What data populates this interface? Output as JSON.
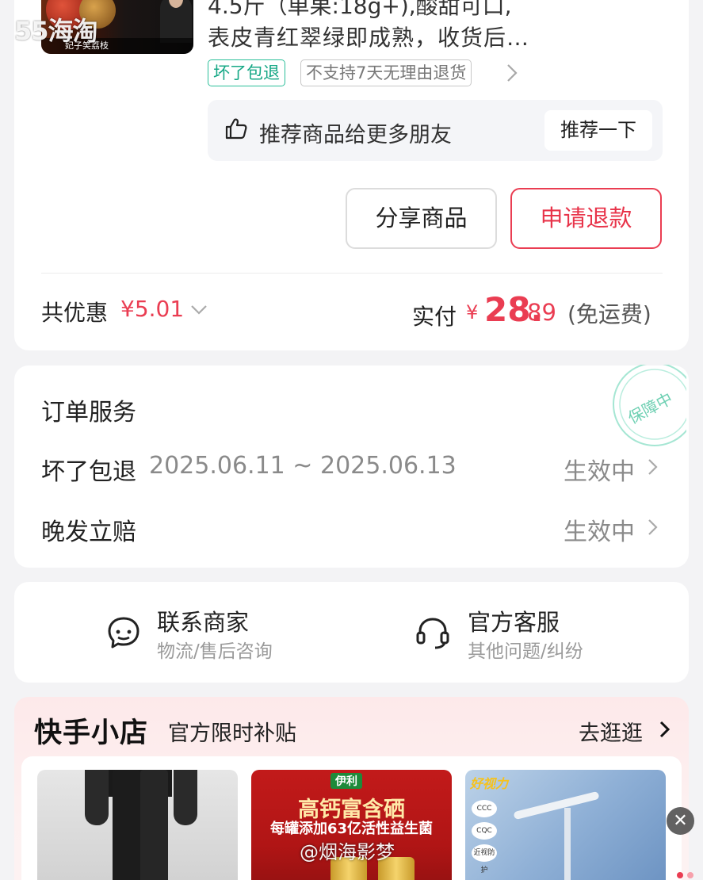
{
  "watermark_top": "55海淘",
  "product": {
    "thumb_caption": "妃子笑荔枝",
    "title_line1": "4.5斤（单果:18g+),酸甜可口,",
    "title_line2": "表皮青红翠绿即成熟，收货后…",
    "tags": [
      "坏了包退",
      "不支持7天无理由退货"
    ],
    "tag_more_icon": "chevron-right-icon"
  },
  "recommend": {
    "label": "推荐商品给更多朋友",
    "button": "推荐一下"
  },
  "actions": {
    "share": "分享商品",
    "refund": "申请退款"
  },
  "summary": {
    "discount_label": "共优惠",
    "discount_value": "¥5.01",
    "paid_label": "实付",
    "paid_currency": "¥",
    "paid_int": "28.",
    "paid_dec": "89",
    "shipping": "(免运费)"
  },
  "order_service": {
    "title": "订单服务",
    "stamp": "保障中",
    "rows": [
      {
        "label": "坏了包退",
        "date": "2025.06.11 ~ 2025.06.13",
        "status": "生效中"
      },
      {
        "label": "晚发立赔",
        "date": "",
        "status": "生效中"
      }
    ]
  },
  "contact": [
    {
      "title": "联系商家",
      "sub": "物流/售后咨询",
      "icon": "chat-bubble-icon"
    },
    {
      "title": "官方客服",
      "sub": "其他问题/纠纷",
      "icon": "headset-icon"
    }
  ],
  "shop": {
    "title": "快手小店",
    "subtitle": "官方限时补贴",
    "more": "去逛逛",
    "products": [
      {
        "kind": "pants"
      },
      {
        "brand": "伊利",
        "headline": "高钙富含硒",
        "line2": "每罐添加63亿活性益生菌"
      },
      {
        "brand": "好视力",
        "badges": [
          "CCC",
          "CQC",
          "近视防护"
        ]
      }
    ]
  },
  "overlay_watermark": "@烟海影梦",
  "colors": {
    "accent_red": "#ea3d52",
    "tag_green": "#17a886"
  }
}
